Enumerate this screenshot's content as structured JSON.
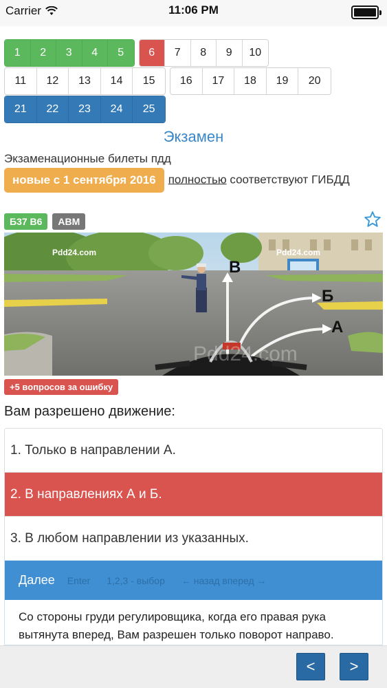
{
  "status_bar": {
    "carrier": "Carrier",
    "time": "11:06 PM"
  },
  "grid": {
    "row1": [
      {
        "type": "green",
        "items": [
          "1",
          "2",
          "3",
          "4",
          "5"
        ]
      },
      {
        "type": "mixed",
        "items": [
          "6",
          "7",
          "8",
          "9",
          "10"
        ],
        "red_index": 0
      }
    ],
    "row2": [
      {
        "type": "plain",
        "items": [
          "11",
          "12",
          "13",
          "14",
          "15"
        ]
      },
      {
        "type": "plain",
        "items": [
          "16",
          "17",
          "18",
          "19",
          "20"
        ]
      }
    ],
    "row3": [
      {
        "type": "blue",
        "items": [
          "21",
          "22",
          "23",
          "24",
          "25"
        ]
      }
    ]
  },
  "exam_title": "Экзамен",
  "intro": {
    "text_before": "Экзаменационные билеты пдд",
    "badge": "новые с 1 сентября 2016",
    "link": "полностью",
    "text_after": " соответствуют ГИБДД"
  },
  "tags": {
    "ticket": "Б37 В6",
    "category": "ABM"
  },
  "scene": {
    "watermark": "Pdd24.com",
    "arrow_v": "В",
    "arrow_b": "Б",
    "arrow_a": "А"
  },
  "penalty_badge": "+5 вопросов за ошибку",
  "question": "Вам разрешено движение:",
  "answers": [
    {
      "text": "1. Только в направлении А.",
      "state": "normal"
    },
    {
      "text": "2. В направлениях А и Б.",
      "state": "wrong"
    },
    {
      "text": "3. В любом направлении из указанных.",
      "state": "normal"
    }
  ],
  "panel": {
    "next_label": "Далее",
    "hint_enter": "Enter",
    "hint_select": "1,2,3 - выбор",
    "hint_nav": "← назад   вперед →",
    "explanation": "Со стороны груди регулировщика, когда его правая рука вытянута вперед, Вам разрешен только поворот направо."
  },
  "nav": {
    "prev": "<",
    "next": ">"
  },
  "colors": {
    "green": "#5cb85c",
    "red": "#d9534f",
    "blue": "#337ab7",
    "orange": "#f0ad4e",
    "title_blue": "#3a87c8"
  }
}
